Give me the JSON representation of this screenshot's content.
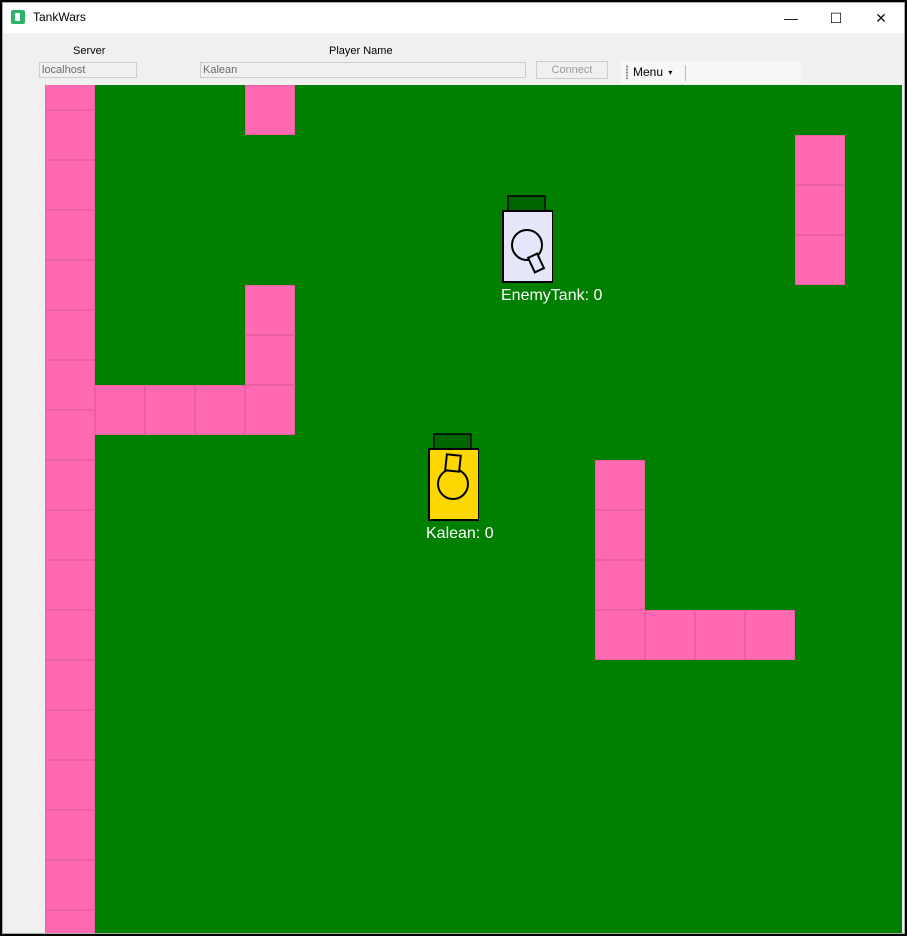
{
  "window": {
    "title": "TankWars",
    "controls": {
      "minimize": "—",
      "maximize": "☐",
      "close": "✕"
    }
  },
  "toolbar": {
    "server_label": "Server",
    "server_value": "localhost",
    "player_label": "Player Name",
    "player_value": "Kalean",
    "connect_label": "Connect",
    "menu_label": "Menu",
    "menu_arrow": "▾"
  },
  "game": {
    "colors": {
      "ground": "#007f00",
      "wall": "#ff69b4"
    },
    "tanks": [
      {
        "name": "EnemyTank",
        "score": "EnemyTank: 0",
        "color": "#e6e6fa"
      },
      {
        "name": "Kalean",
        "score": "Kalean: 0",
        "color": "#ffd700"
      }
    ]
  }
}
